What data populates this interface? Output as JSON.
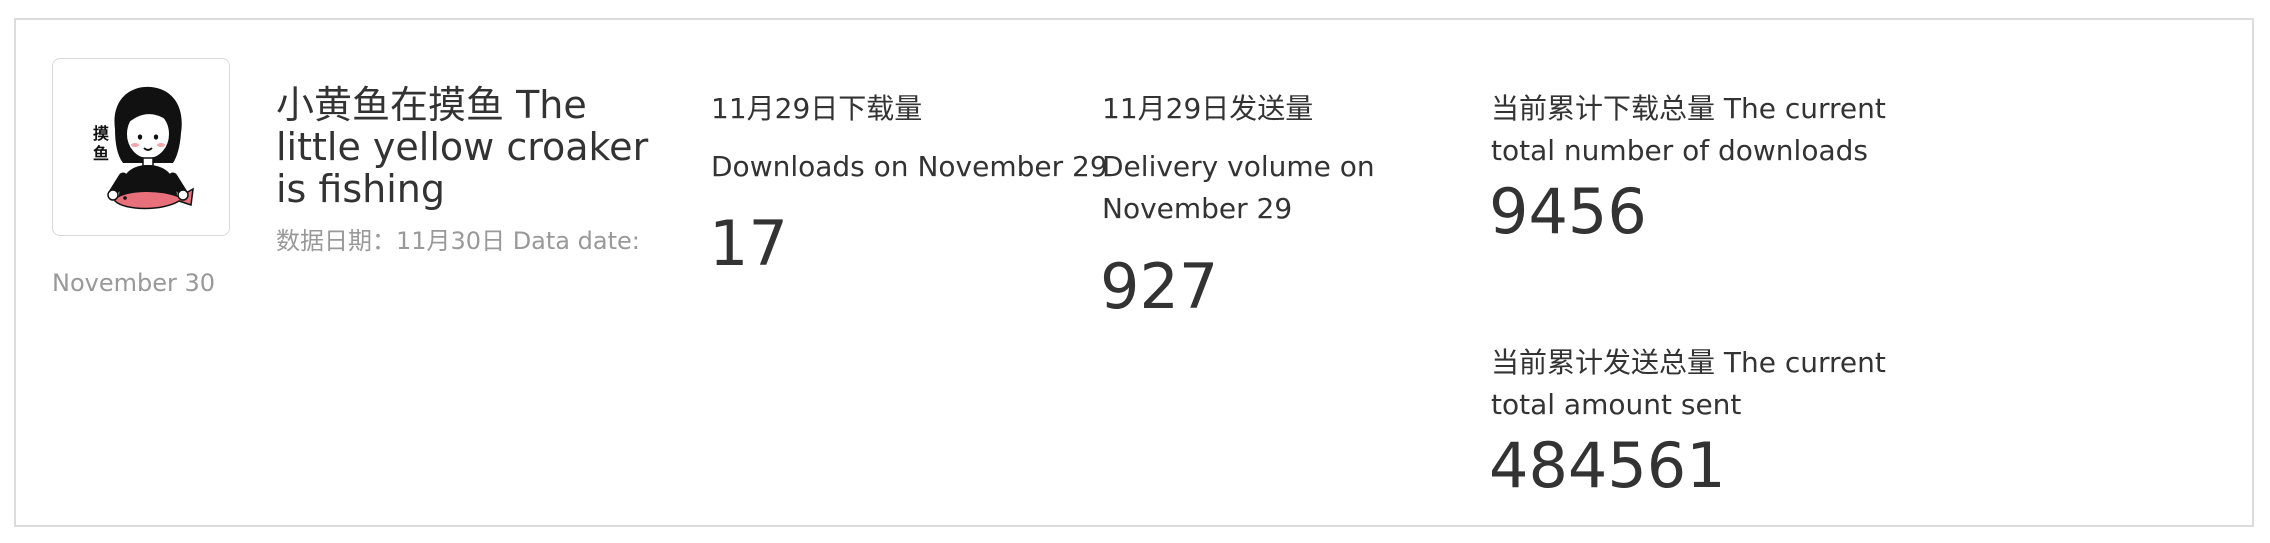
{
  "brand": {
    "title": "小黄鱼在摸鱼 The little yellow croaker is fishing",
    "avatar_text": "摸鱼",
    "data_date_part1": "数据日期：11月30日 Data date:",
    "data_date_part2": "November 30"
  },
  "stats": {
    "downloads_day": {
      "label_cn": "11月29日下载量",
      "label_en": "Downloads on November 29",
      "value": "17"
    },
    "delivery_day": {
      "label_cn": "11月29日发送量",
      "label_en": "Delivery volume on November 29",
      "value": "927"
    },
    "total_downloads": {
      "label": "当前累计下载总量 The current total number of downloads",
      "value": "9456"
    },
    "total_sent": {
      "label": "当前累计发送总量 The current total amount sent",
      "value": "484561"
    }
  },
  "colors": {
    "text": "#333333",
    "muted": "#999999",
    "border": "#dcdcdc",
    "fish": "#e8707a"
  }
}
